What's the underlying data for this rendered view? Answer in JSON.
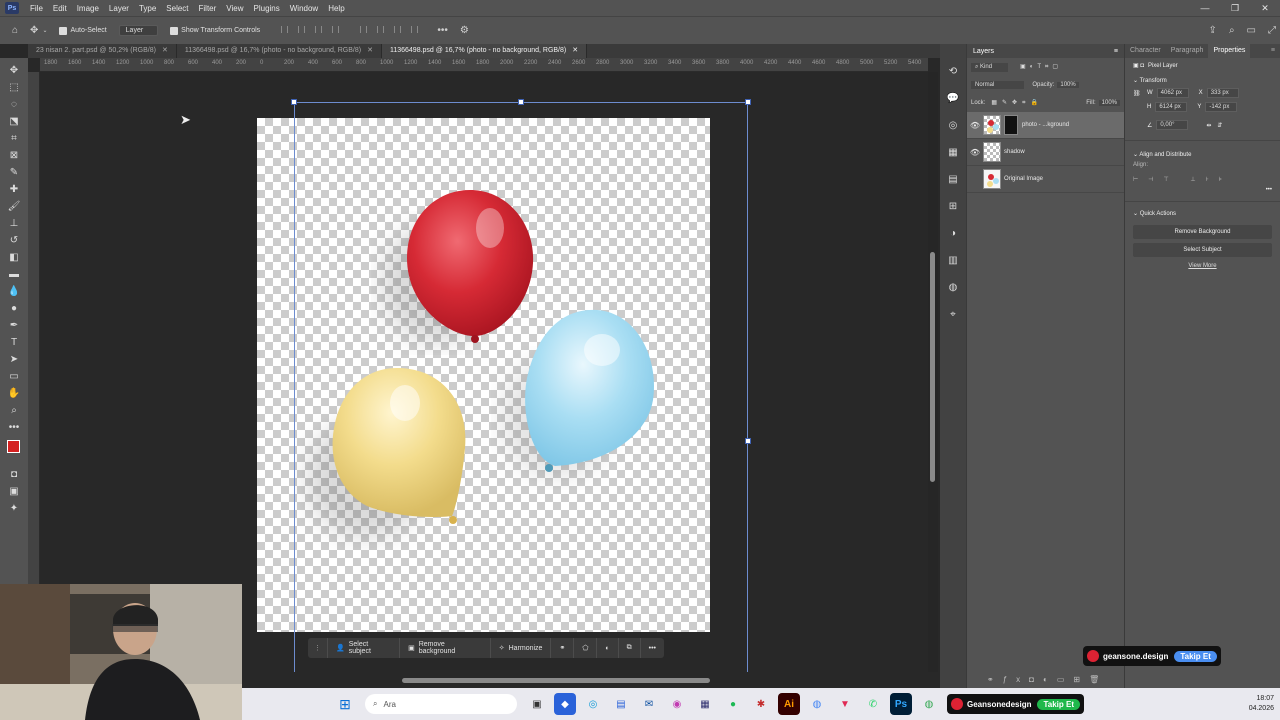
{
  "app": {
    "logo": "Ps"
  },
  "menu": [
    "File",
    "Edit",
    "Image",
    "Layer",
    "Type",
    "Select",
    "Filter",
    "View",
    "Plugins",
    "Window",
    "Help"
  ],
  "window_controls": {
    "minimize": "—",
    "restore": "❐",
    "close": "✕"
  },
  "options_bar": {
    "auto_select_label": "Auto-Select",
    "auto_select_target": "Layer",
    "show_transform_label": "Show Transform Controls",
    "more": "•••"
  },
  "document_tabs": [
    {
      "label": "23 nisan 2. part.psd @ 50,2% (RGB/8)",
      "active": false,
      "close": "✕"
    },
    {
      "label": "11366498.psd @ 16,7% (photo - no background, RGB/8)",
      "active": false,
      "close": "✕"
    },
    {
      "label": "11366498.psd @ 16,7% (photo - no background, RGB/8)",
      "active": true,
      "close": "✕"
    }
  ],
  "ruler_labels": [
    "1800",
    "1600",
    "1400",
    "1200",
    "1000",
    "800",
    "600",
    "400",
    "200",
    "0",
    "200",
    "400",
    "600",
    "800",
    "1000",
    "1200",
    "1400",
    "1600",
    "1800",
    "2000",
    "2200",
    "2400",
    "2600",
    "2800",
    "3000",
    "3200",
    "3400",
    "3600",
    "3800",
    "4000",
    "4200",
    "4400",
    "4600",
    "4800",
    "5000",
    "5200",
    "5400",
    "5600"
  ],
  "contextual_taskbar": {
    "select_subject": "Select subject",
    "remove_background": "Remove background",
    "harmonize": "Harmonize",
    "more": "•••"
  },
  "layers_panel": {
    "title": "Layers",
    "filter_kind": "Kind",
    "blend_mode": "Normal",
    "opacity_label": "Opacity:",
    "opacity_value": "100%",
    "lock_label": "Lock:",
    "fill_label": "Fill:",
    "fill_value": "100%",
    "layers": [
      {
        "name": "photo - ...kground",
        "visible": true,
        "selected": true
      },
      {
        "name": "shadow",
        "visible": true,
        "selected": false
      },
      {
        "name": "Original Image",
        "visible": false,
        "selected": false
      }
    ]
  },
  "properties_panel": {
    "tabs": [
      "Character",
      "Paragraph",
      "Properties"
    ],
    "active_tab": "Properties",
    "layer_type": "Pixel Layer",
    "transform": {
      "title": "Transform",
      "w_label": "W",
      "w": "4062 px",
      "h_label": "H",
      "h": "6124 px",
      "x_label": "X",
      "x": "333 px",
      "y_label": "Y",
      "y": "-142 px",
      "angle": "0,00°"
    },
    "align": {
      "title": "Align and Distribute",
      "align_label": "Align:",
      "more": "•••"
    },
    "quick_actions": {
      "title": "Quick Actions",
      "remove_background": "Remove Background",
      "select_subject": "Select Subject",
      "view_more": "View More"
    }
  },
  "overlay_badges": {
    "panel_name": "geansone.design",
    "panel_follow": "Takip Et",
    "taskbar_name": "Geansonedesign",
    "taskbar_follow": "Takip Et"
  },
  "taskbar": {
    "search_placeholder": "Ara",
    "time": "18:07",
    "date": "04.2026"
  },
  "colors": {
    "accent_blue": "#4a8ef0",
    "follow_green": "#1fb84b",
    "foreground": "#d42020",
    "background": "#ffffff",
    "balloon_red": "#d62a35",
    "balloon_blue": "#a9def3",
    "balloon_yellow": "#f3dc8c"
  }
}
